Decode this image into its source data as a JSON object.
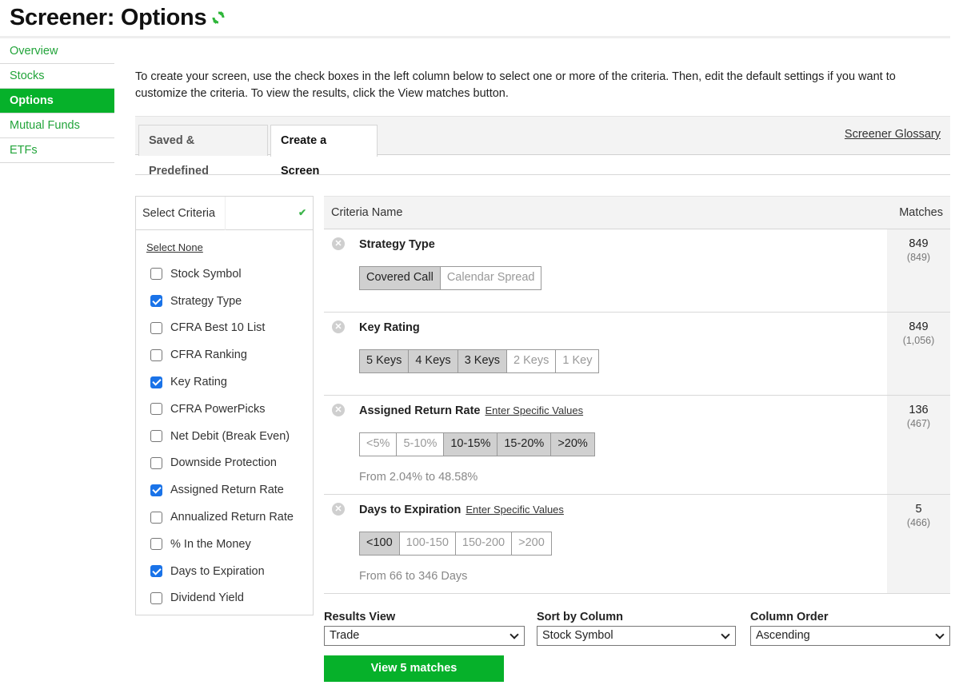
{
  "header": {
    "title": "Screener: Options",
    "refresh_icon": "refresh-icon"
  },
  "sidebar": {
    "items": [
      {
        "label": "Overview",
        "active": false
      },
      {
        "label": "Stocks",
        "active": false
      },
      {
        "label": "Options",
        "active": true
      },
      {
        "label": "Mutual Funds",
        "active": false
      },
      {
        "label": "ETFs",
        "active": false
      }
    ]
  },
  "intro": "To create your screen, use the check boxes in the left column below to select one or more of the criteria. Then, edit the default settings if you want to customize the criteria. To view the results, click the View matches button.",
  "tabs": [
    {
      "label": "Saved & Predefined",
      "active": false
    },
    {
      "label": "Create a Screen",
      "active": true
    }
  ],
  "glossary_link": "Screener Glossary",
  "criteria_panel": {
    "header": "Select Criteria",
    "select_none": "Select None",
    "items": [
      {
        "label": "Stock Symbol",
        "checked": false
      },
      {
        "label": "Strategy Type",
        "checked": true
      },
      {
        "label": "CFRA Best 10 List",
        "checked": false
      },
      {
        "label": "CFRA Ranking",
        "checked": false
      },
      {
        "label": "Key Rating",
        "checked": true
      },
      {
        "label": "CFRA PowerPicks",
        "checked": false
      },
      {
        "label": "Net Debit (Break Even)",
        "checked": false
      },
      {
        "label": "Downside Protection",
        "checked": false
      },
      {
        "label": "Assigned Return Rate",
        "checked": true
      },
      {
        "label": "Annualized Return Rate",
        "checked": false
      },
      {
        "label": "% In the Money",
        "checked": false
      },
      {
        "label": "Days to Expiration",
        "checked": true
      },
      {
        "label": "Dividend Yield",
        "checked": false
      }
    ]
  },
  "table": {
    "col_name": "Criteria Name",
    "col_matches": "Matches",
    "rows": [
      {
        "name": "Strategy Type",
        "link": "",
        "options": [
          {
            "label": "Covered Call",
            "selected": true
          },
          {
            "label": "Calendar Spread",
            "selected": false
          }
        ],
        "range": "",
        "matches": "849",
        "total": "(849)"
      },
      {
        "name": "Key Rating",
        "link": "",
        "options": [
          {
            "label": "5 Keys",
            "selected": true
          },
          {
            "label": "4 Keys",
            "selected": true
          },
          {
            "label": "3 Keys",
            "selected": true
          },
          {
            "label": "2 Keys",
            "selected": false
          },
          {
            "label": "1 Key",
            "selected": false
          }
        ],
        "range": "",
        "matches": "849",
        "total": "(1,056)"
      },
      {
        "name": "Assigned Return Rate",
        "link": "Enter Specific Values",
        "options": [
          {
            "label": "<5%",
            "selected": false
          },
          {
            "label": "5-10%",
            "selected": false
          },
          {
            "label": "10-15%",
            "selected": true
          },
          {
            "label": "15-20%",
            "selected": true
          },
          {
            "label": ">20%",
            "selected": true
          }
        ],
        "range": "From 2.04% to 48.58%",
        "matches": "136",
        "total": "(467)"
      },
      {
        "name": "Days to Expiration",
        "link": "Enter Specific Values",
        "options": [
          {
            "label": "<100",
            "selected": true
          },
          {
            "label": "100-150",
            "selected": false
          },
          {
            "label": "150-200",
            "selected": false
          },
          {
            "label": ">200",
            "selected": false
          }
        ],
        "range": "From 66 to 346 Days",
        "matches": "5",
        "total": "(466)"
      }
    ]
  },
  "controls": {
    "results_view": {
      "label": "Results View",
      "value": "Trade"
    },
    "sort_by": {
      "label": "Sort by Column",
      "value": "Stock Symbol"
    },
    "order": {
      "label": "Column Order",
      "value": "Ascending"
    },
    "view_button": "View 5 matches"
  },
  "colors": {
    "brand_green": "#06b12a",
    "link_green": "#22a43a",
    "checkbox_blue": "#1a73e8"
  }
}
